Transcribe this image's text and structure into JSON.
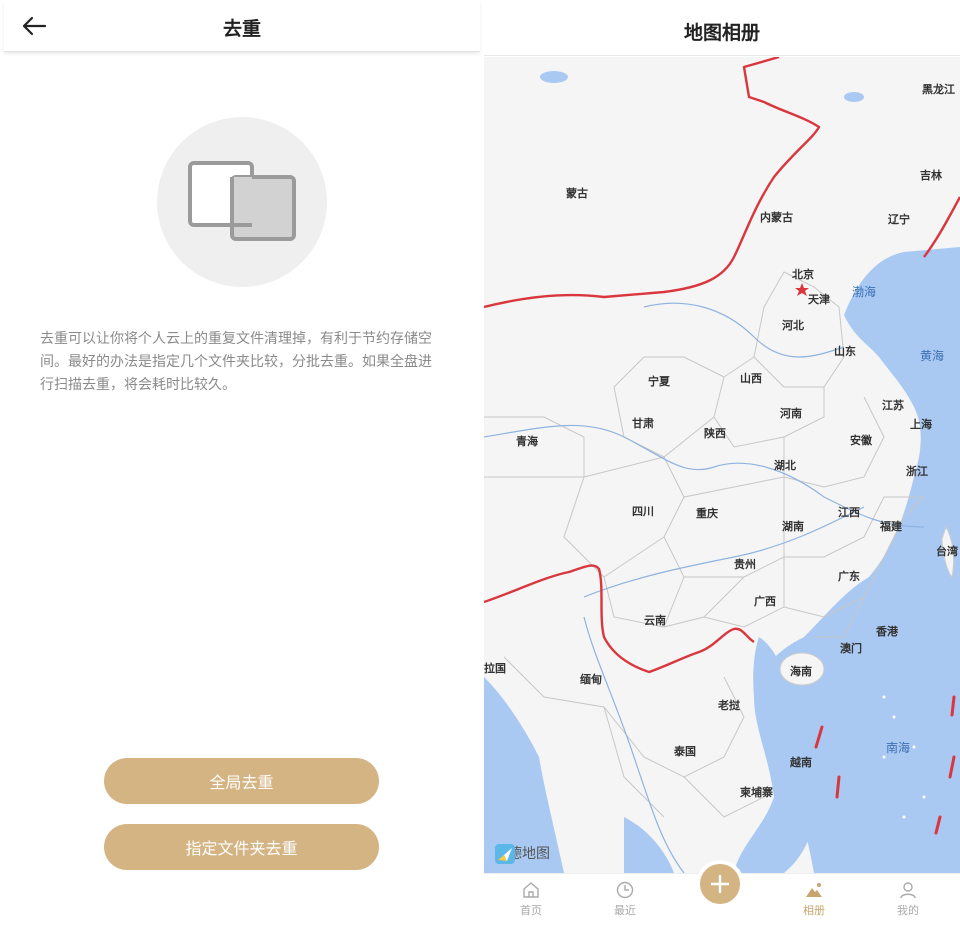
{
  "dedupe": {
    "title": "去重",
    "description": "去重可以让你将个人云上的重复文件清理掉，有利于节约存储空间。最好的办法是指定几个文件夹比较，分批去重。如果全盘进行扫描去重，将会耗时比较久。",
    "buttons": {
      "global": "全局去重",
      "folder": "指定文件夹去重"
    }
  },
  "album": {
    "title": "地图相册",
    "map_attribution": "高德地图",
    "labels": {
      "heilongjiang": "黑龙江",
      "mongolia": "蒙古",
      "jilin": "吉林",
      "neimenggu": "内蒙古",
      "liaoning": "辽宁",
      "beijing": "北京",
      "tianjin": "天津",
      "hebei": "河北",
      "shandong": "山东",
      "ningxia": "宁夏",
      "shanxi": "山西",
      "gansu": "甘肃",
      "qinghai": "青海",
      "shaanxi": "陕西",
      "henan": "河南",
      "jiangsu": "江苏",
      "shanghai": "上海",
      "anhui": "安徽",
      "hubei": "湖北",
      "zhejiang": "浙江",
      "sichuan": "四川",
      "chongqing": "重庆",
      "jiangxi": "江西",
      "hunan": "湖南",
      "fujian": "福建",
      "taiwan": "台湾",
      "guizhou": "贵州",
      "guangdong": "广东",
      "guangxi": "广西",
      "yunnan": "云南",
      "hongkong": "香港",
      "macau": "澳门",
      "hainan": "海南",
      "laos": "老挝",
      "myanmar": "缅甸",
      "bangladesh": "拉国",
      "thailand": "泰国",
      "vietnam": "越南",
      "cambodia": "柬埔寨"
    },
    "seas": {
      "bohai": "渤海",
      "yellow": "黄海",
      "south": "南海"
    },
    "tabs": {
      "home": "首页",
      "recent": "最近",
      "album": "相册",
      "mine": "我的"
    }
  },
  "colors": {
    "accent": "#d4b483",
    "border_red": "#d9363e",
    "sea": "#a9c9f2",
    "land": "#f4f5f4"
  }
}
